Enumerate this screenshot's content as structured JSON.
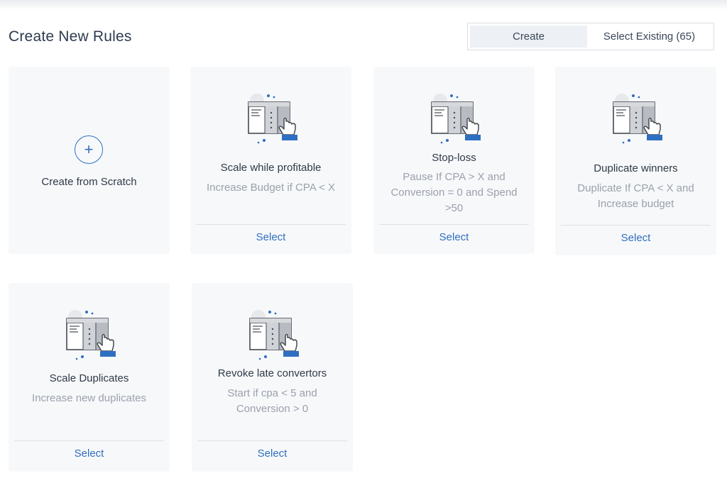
{
  "page": {
    "title": "Create New Rules"
  },
  "toggle": {
    "create_label": "Create",
    "select_existing_label": "Select Existing (65)"
  },
  "scratch_card": {
    "title": "Create from Scratch",
    "icon": "plus-icon"
  },
  "templates": [
    {
      "title": "Scale while profitable",
      "description": "Increase Budget if CPA < X",
      "select_label": "Select"
    },
    {
      "title": "Stop-loss",
      "description": "Pause If CPA > X and Conversion = 0 and Spend >50",
      "select_label": "Select"
    },
    {
      "title": "Duplicate winners",
      "description": "Duplicate If CPA < X and Increase budget",
      "select_label": "Select"
    },
    {
      "title": "Scale Duplicates",
      "description": "Increase new duplicates",
      "select_label": "Select"
    },
    {
      "title": "Revoke late convertors",
      "description": "Start if cpa < 5 and Conversion > 0",
      "select_label": "Select"
    }
  ],
  "colors": {
    "accent": "#2f6fc1",
    "card_bg": "#f7f8fa",
    "text_primary": "#2f3a48",
    "text_muted": "#9aa1ab"
  }
}
